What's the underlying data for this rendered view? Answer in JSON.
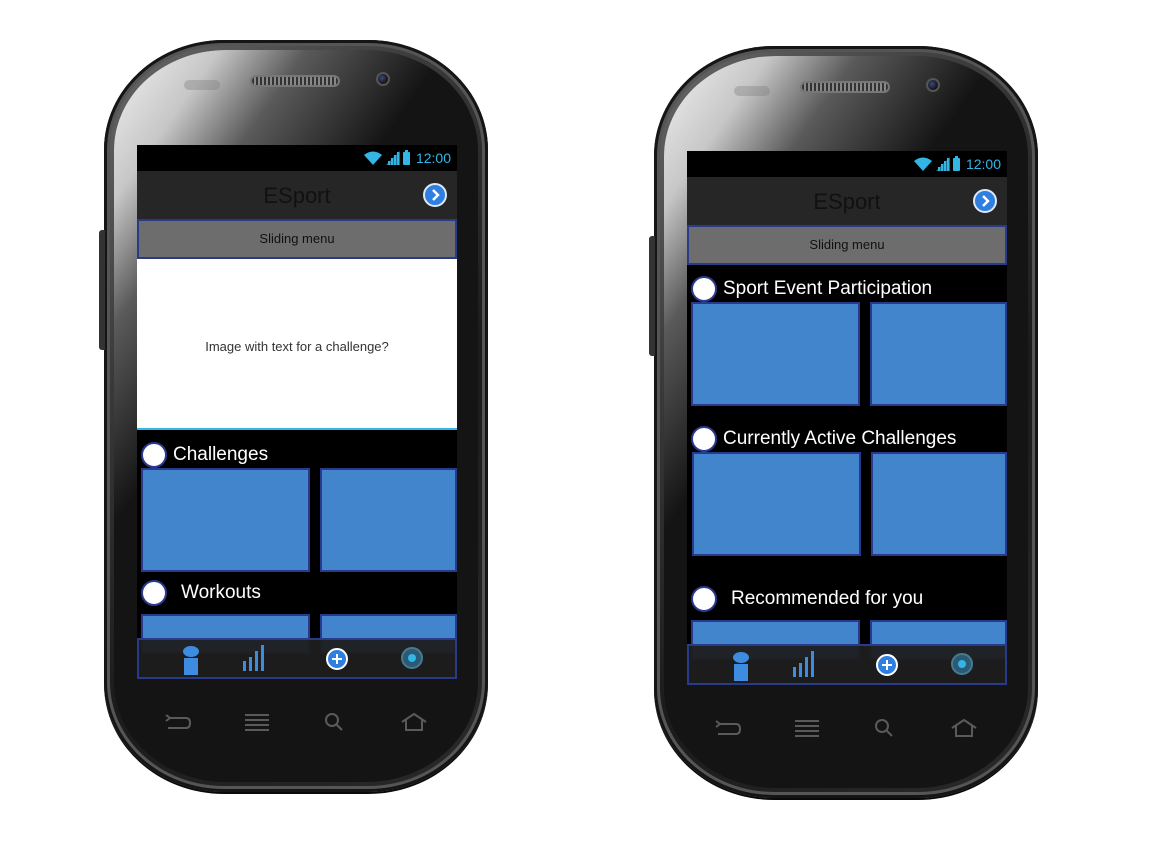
{
  "phones": [
    {
      "status_bar": {
        "time": "12:00",
        "icons": [
          "wifi-icon",
          "signal-icon",
          "battery-icon"
        ]
      },
      "action_bar": {
        "title": "ESport",
        "action_icon": "chevron-right-icon"
      },
      "sliding_menu_label": "Sliding menu",
      "hero_text": "Image with text for a challenge?",
      "sections": [
        {
          "title": "Challenges"
        },
        {
          "title": "Workouts"
        }
      ],
      "bottom_nav": [
        "person-icon",
        "stats-icon",
        "add-icon",
        "record-icon"
      ]
    },
    {
      "status_bar": {
        "time": "12:00",
        "icons": [
          "wifi-icon",
          "signal-icon",
          "battery-icon"
        ]
      },
      "action_bar": {
        "title": "ESport",
        "action_icon": "chevron-right-icon"
      },
      "sliding_menu_label": "Sliding menu",
      "sections": [
        {
          "title": "Sport Event Participation"
        },
        {
          "title": "Currently Active Challenges"
        },
        {
          "title": "Recommended for you"
        }
      ],
      "bottom_nav": [
        "person-icon",
        "stats-icon",
        "add-icon",
        "record-icon"
      ]
    }
  ],
  "colors": {
    "tile": "#4285cd",
    "tile_border": "#283a8a",
    "accent": "#33b5e5",
    "action_bar": "#262626",
    "sliding_menu": "#6d6d6d"
  }
}
